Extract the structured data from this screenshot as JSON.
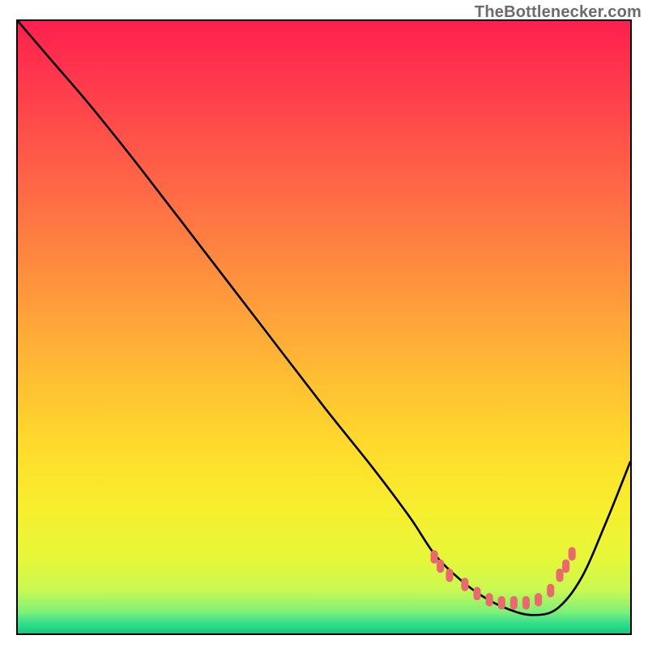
{
  "watermark_text": "TheBottlenecker.com",
  "gradient_stops": [
    {
      "offset": 0.0,
      "color": "#ff1f4f"
    },
    {
      "offset": 0.1,
      "color": "#ff3a4d"
    },
    {
      "offset": 0.22,
      "color": "#ff5a48"
    },
    {
      "offset": 0.35,
      "color": "#ff7d42"
    },
    {
      "offset": 0.48,
      "color": "#ffa23a"
    },
    {
      "offset": 0.6,
      "color": "#ffc232"
    },
    {
      "offset": 0.7,
      "color": "#ffdc2c"
    },
    {
      "offset": 0.8,
      "color": "#f7ef2e"
    },
    {
      "offset": 0.88,
      "color": "#e6f73a"
    },
    {
      "offset": 0.93,
      "color": "#c8f852"
    },
    {
      "offset": 0.965,
      "color": "#7df07a"
    },
    {
      "offset": 0.985,
      "color": "#2fdd8d"
    },
    {
      "offset": 1.0,
      "color": "#17c978"
    }
  ],
  "chart_data": {
    "type": "line",
    "title": "",
    "xlabel": "",
    "ylabel": "",
    "xlim": [
      0,
      100
    ],
    "ylim": [
      0,
      100
    ],
    "grid": false,
    "legend": false,
    "series": [
      {
        "name": "bottleneck-curve",
        "x": [
          0,
          6,
          12,
          20,
          30,
          40,
          50,
          58,
          64,
          68,
          72,
          76,
          80,
          84,
          88,
          92,
          96,
          100
        ],
        "y": [
          100,
          93,
          86,
          76,
          63,
          50,
          37,
          27,
          19,
          13,
          9,
          6,
          4,
          3,
          4,
          9,
          18,
          28
        ]
      }
    ],
    "markers": {
      "name": "highlight-dots",
      "shape": "rounded-rect",
      "color": "#e96a6d",
      "points": [
        {
          "x": 68.0,
          "y": 12.5
        },
        {
          "x": 69.0,
          "y": 11.0
        },
        {
          "x": 70.5,
          "y": 9.5
        },
        {
          "x": 73.0,
          "y": 8.0
        },
        {
          "x": 75.0,
          "y": 6.5
        },
        {
          "x": 77.0,
          "y": 5.5
        },
        {
          "x": 79.0,
          "y": 5.0
        },
        {
          "x": 81.0,
          "y": 5.0
        },
        {
          "x": 83.0,
          "y": 5.0
        },
        {
          "x": 85.0,
          "y": 5.5
        },
        {
          "x": 87.0,
          "y": 7.0
        },
        {
          "x": 88.5,
          "y": 9.5
        },
        {
          "x": 89.5,
          "y": 11.0
        },
        {
          "x": 90.5,
          "y": 13.0
        }
      ]
    }
  }
}
